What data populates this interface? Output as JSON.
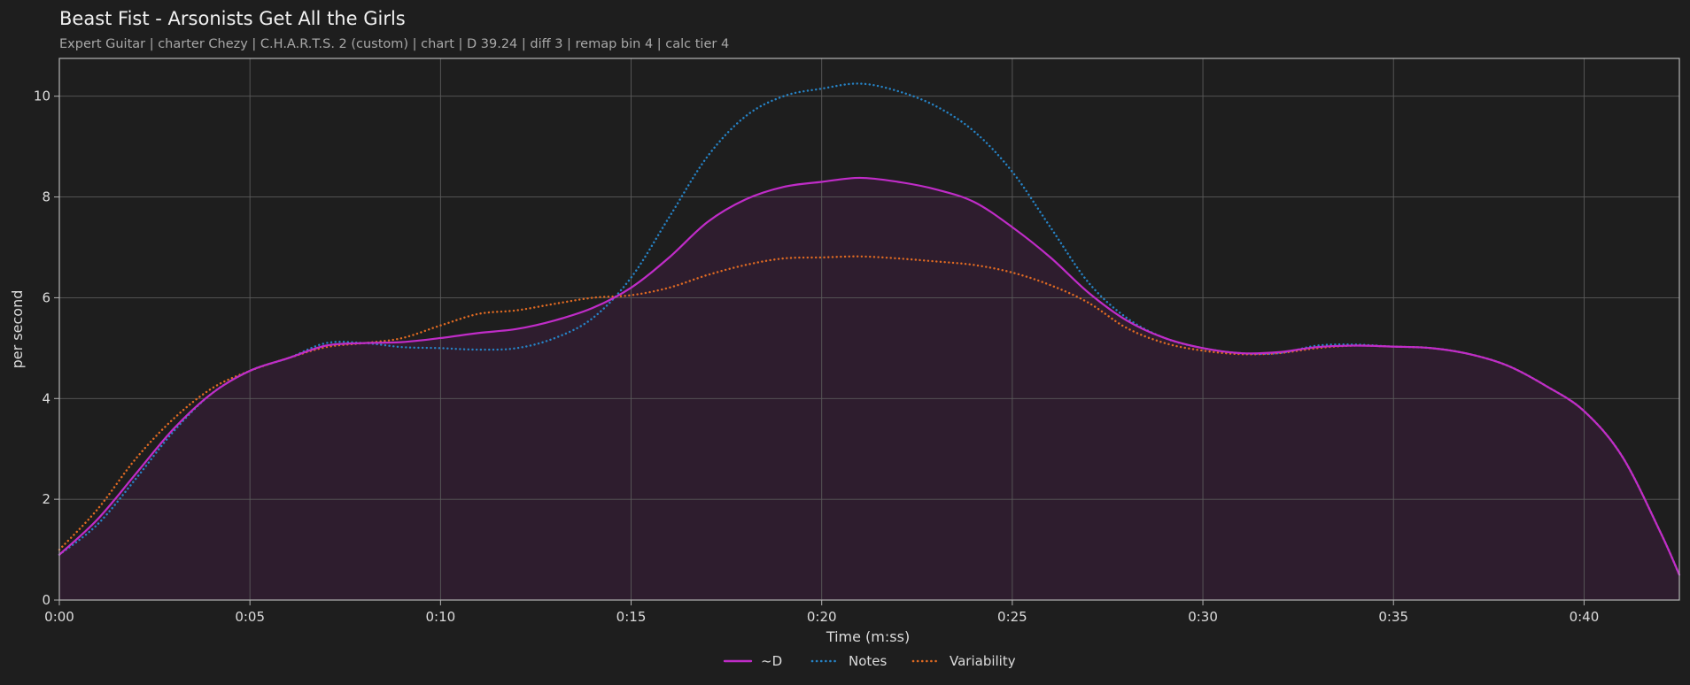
{
  "chart_data": {
    "type": "line",
    "title": "Beast Fist - Arsonists Get All the Girls",
    "subtitle": "Expert Guitar  |  charter Chezy  |  C.H.A.R.T.S. 2 (custom)  |  chart  |  D 39.24  |  diff 3  |  remap bin 4  |  calc tier 4",
    "xlabel": "Time (m:ss)",
    "ylabel": "per second",
    "xlim": [
      0,
      42.5
    ],
    "ylim": [
      0,
      10.75
    ],
    "x_ticks": [
      {
        "value": 0,
        "label": "0:00"
      },
      {
        "value": 5,
        "label": "0:05"
      },
      {
        "value": 10,
        "label": "0:10"
      },
      {
        "value": 15,
        "label": "0:15"
      },
      {
        "value": 20,
        "label": "0:20"
      },
      {
        "value": 25,
        "label": "0:25"
      },
      {
        "value": 30,
        "label": "0:30"
      },
      {
        "value": 35,
        "label": "0:35"
      },
      {
        "value": 40,
        "label": "0:40"
      }
    ],
    "y_ticks": [
      {
        "value": 0,
        "label": "0"
      },
      {
        "value": 2,
        "label": "2"
      },
      {
        "value": 4,
        "label": "4"
      },
      {
        "value": 6,
        "label": "6"
      },
      {
        "value": 8,
        "label": "8"
      },
      {
        "value": 10,
        "label": "10"
      }
    ],
    "grid": true,
    "legend_position": "bottom-center",
    "x": [
      0,
      1,
      2,
      3,
      4,
      5,
      6,
      7,
      8,
      9,
      10,
      11,
      12,
      13,
      14,
      15,
      16,
      17,
      18,
      19,
      20,
      21,
      22,
      23,
      24,
      25,
      26,
      27,
      28,
      29,
      30,
      31,
      32,
      33,
      34,
      35,
      36,
      37,
      38,
      39,
      40,
      41,
      42,
      42.5
    ],
    "series": [
      {
        "name": "~D",
        "color": "#c02cc8",
        "style": "solid",
        "fill": "#2e1d2e",
        "values": [
          0.9,
          1.6,
          2.5,
          3.4,
          4.1,
          4.55,
          4.8,
          5.05,
          5.1,
          5.12,
          5.2,
          5.3,
          5.38,
          5.55,
          5.8,
          6.2,
          6.8,
          7.5,
          7.95,
          8.2,
          8.3,
          8.38,
          8.3,
          8.15,
          7.9,
          7.4,
          6.8,
          6.1,
          5.55,
          5.2,
          5.0,
          4.9,
          4.92,
          5.02,
          5.05,
          5.03,
          5.0,
          4.88,
          4.65,
          4.25,
          3.75,
          2.85,
          1.35,
          0.5
        ]
      },
      {
        "name": "Notes",
        "color": "#2683c6",
        "style": "dotted",
        "values": [
          0.9,
          1.5,
          2.4,
          3.35,
          4.1,
          4.55,
          4.8,
          5.1,
          5.1,
          5.02,
          5.0,
          4.97,
          5.0,
          5.2,
          5.6,
          6.4,
          7.6,
          8.8,
          9.6,
          10.0,
          10.15,
          10.25,
          10.1,
          9.8,
          9.3,
          8.5,
          7.4,
          6.3,
          5.6,
          5.2,
          5.0,
          4.9,
          4.9,
          5.05,
          5.07,
          5.03,
          5.0,
          4.88,
          4.65,
          4.25,
          3.75,
          2.85,
          1.35,
          0.5
        ]
      },
      {
        "name": "Variability",
        "color": "#e06a22",
        "style": "dotted",
        "values": [
          1.0,
          1.8,
          2.8,
          3.6,
          4.2,
          4.55,
          4.8,
          5.02,
          5.1,
          5.2,
          5.45,
          5.68,
          5.75,
          5.88,
          6.0,
          6.05,
          6.2,
          6.45,
          6.65,
          6.78,
          6.8,
          6.82,
          6.78,
          6.72,
          6.65,
          6.5,
          6.25,
          5.9,
          5.4,
          5.1,
          4.95,
          4.88,
          4.9,
          5.0,
          5.05,
          5.03,
          5.0,
          4.88,
          4.65,
          4.25,
          3.75,
          2.85,
          1.35,
          0.5
        ]
      }
    ]
  }
}
